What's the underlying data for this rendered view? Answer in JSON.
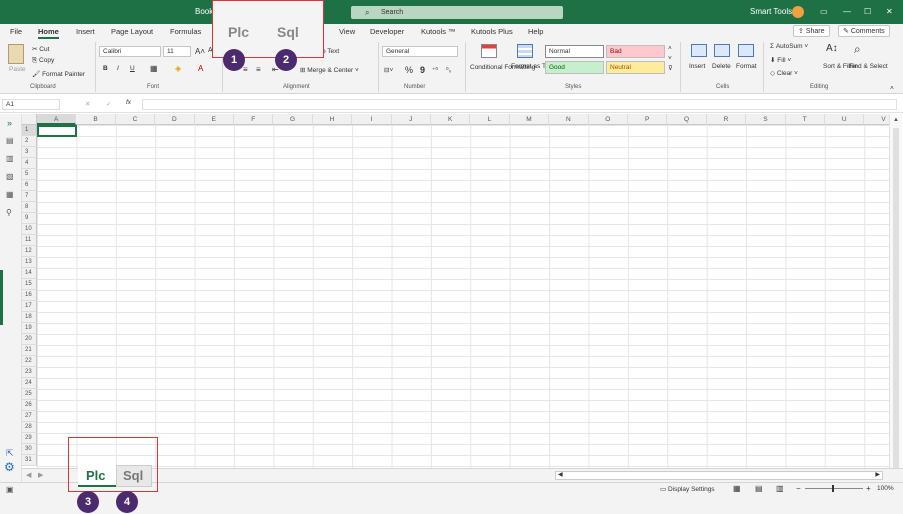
{
  "title_bar": {
    "doc_name": "Book",
    "search_placeholder": "Search",
    "user": "Smart Tools"
  },
  "menu": [
    "File",
    "Home",
    "Insert",
    "Page Layout",
    "Formulas",
    "View",
    "Developer",
    "Kutools ™",
    "Kutools Plus",
    "Help"
  ],
  "share_label": "Share",
  "comments_label": "Comments",
  "clipboard": {
    "paste": "Paste",
    "cut": "Cut",
    "copy": "Copy",
    "format_painter": "Format Painter",
    "label": "Clipboard"
  },
  "font": {
    "name": "Calibri",
    "size": "11",
    "bold": "B",
    "italic": "I",
    "underline": "U",
    "label": "Font"
  },
  "alignment": {
    "wrap_text": "p Text",
    "merge_center": "Merge & Center",
    "label": "Alignment"
  },
  "number": {
    "format": "General",
    "percent": "%",
    "comma": "9",
    "label": "Number"
  },
  "styles": {
    "conditional_formatting": "Conditional Formatting",
    "format_as_table": "Format as Table",
    "normal": "Normal",
    "bad": "Bad",
    "good": "Good",
    "neutral": "Neutral",
    "label": "Styles"
  },
  "cells": {
    "insert": "Insert",
    "delete": "Delete",
    "format": "Format",
    "label": "Cells"
  },
  "editing": {
    "autosum": "AutoSum",
    "fill": "Fill",
    "clear": "Clear",
    "sort_filter": "Sort & Filter",
    "find_select": "Find & Select",
    "label": "Editing"
  },
  "name_box": "A1",
  "fx": "fx",
  "columns": [
    "A",
    "B",
    "C",
    "D",
    "E",
    "F",
    "G",
    "H",
    "I",
    "J",
    "K",
    "L",
    "M",
    "N",
    "O",
    "P",
    "Q",
    "R",
    "S",
    "T",
    "U",
    "V"
  ],
  "rows": [
    "1",
    "2",
    "3",
    "4",
    "5",
    "6",
    "7",
    "8",
    "9",
    "10",
    "11",
    "12",
    "13",
    "14",
    "15",
    "16",
    "17",
    "18",
    "19",
    "20",
    "21",
    "22",
    "23",
    "24",
    "25",
    "26",
    "27",
    "28",
    "29",
    "30",
    "31"
  ],
  "popup_tabs": {
    "plc": "Plc",
    "sql": "Sql"
  },
  "sheet_tabs": {
    "plc": "Plc",
    "sql": "Sql"
  },
  "callouts": [
    "1",
    "2",
    "3",
    "4"
  ],
  "status": {
    "display_settings": "Display Settings",
    "zoom": "100%"
  },
  "colors": {
    "accent": "#1e7145",
    "callout": "#4b2a6e",
    "highlight": "#e03333"
  }
}
